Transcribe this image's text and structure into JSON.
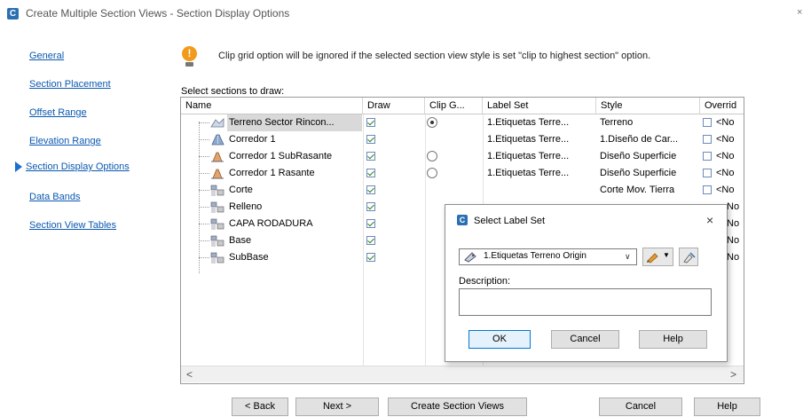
{
  "window": {
    "app_icon_letter": "C",
    "title": "Create Multiple Section Views - Section Display Options",
    "close_glyph": "×"
  },
  "nav": {
    "items": [
      {
        "label": "General",
        "active": false
      },
      {
        "label": "Section Placement",
        "active": false
      },
      {
        "label": "Offset Range",
        "active": false
      },
      {
        "label": "Elevation Range",
        "active": false
      },
      {
        "label": "Section Display Options",
        "active": true
      },
      {
        "label": "Data Bands",
        "active": false
      },
      {
        "label": "Section View Tables",
        "active": false
      }
    ]
  },
  "info": {
    "icon": "lightbulb-icon",
    "message": "Clip grid option will be ignored if the selected section view style is set \"clip to highest section\" option."
  },
  "grid": {
    "caption": "Select sections to draw:",
    "headers": [
      "Name",
      "Draw",
      "Clip G...",
      "Label Set",
      "Style",
      "Overrid"
    ],
    "rows": [
      {
        "name": "Terreno Sector Rincon...",
        "icon": "surface-icon",
        "draw": true,
        "clip": "on",
        "label_set": "1.Etiquetas Terre...",
        "style": "Terreno",
        "override": "<No"
      },
      {
        "name": "Corredor 1",
        "icon": "corridor-icon",
        "draw": true,
        "clip": "none",
        "label_set": "1.Etiquetas Terre...",
        "style": "1.Diseño de Car...",
        "override": "<No"
      },
      {
        "name": "Corredor 1 SubRasante",
        "icon": "corridor-surface-icon",
        "draw": true,
        "clip": "off",
        "label_set": "1.Etiquetas Terre...",
        "style": "Diseño Superficie",
        "override": "<No"
      },
      {
        "name": "Corredor 1 Rasante",
        "icon": "corridor-surface-icon",
        "draw": true,
        "clip": "off",
        "label_set": "1.Etiquetas Terre...",
        "style": "Diseño Superficie",
        "override": "<No"
      },
      {
        "name": "Corte",
        "icon": "material-icon",
        "draw": true,
        "clip": "none",
        "label_set": "",
        "style": "Corte Mov. Tierra",
        "override": "<No"
      },
      {
        "name": "Relleno",
        "icon": "material-icon",
        "draw": true,
        "clip": "none",
        "label_set": "",
        "style": "",
        "override": "No"
      },
      {
        "name": "CAPA RODADURA",
        "icon": "material-icon",
        "draw": true,
        "clip": "none",
        "label_set": "",
        "style": "",
        "override": "No"
      },
      {
        "name": "Base",
        "icon": "material-icon",
        "draw": true,
        "clip": "none",
        "label_set": "",
        "style": "",
        "override": "No"
      },
      {
        "name": "SubBase",
        "icon": "material-icon",
        "draw": true,
        "clip": "none",
        "label_set": "",
        "style": "",
        "override": "No"
      }
    ],
    "scroll_left": "<",
    "scroll_right": ">"
  },
  "dialog": {
    "icon_letter": "C",
    "title": "Select Label Set",
    "close_glyph": "×",
    "combo_value": "1.Etiquetas Terreno Origin",
    "description_label": "Description:",
    "description_value": "",
    "ok_label": "OK",
    "cancel_label": "Cancel",
    "help_label": "Help"
  },
  "footer": {
    "back_label": "< Back",
    "next_label": "Next >",
    "create_label": "Create Section Views",
    "cancel_label": "Cancel",
    "help_label": "Help"
  },
  "colors": {
    "link": "#0a58b0",
    "nav_arrow": "#1a6fd0",
    "selected_row": "#d9d9d9",
    "check": "#2e7d32",
    "info_bulb": "#f29a1c"
  }
}
